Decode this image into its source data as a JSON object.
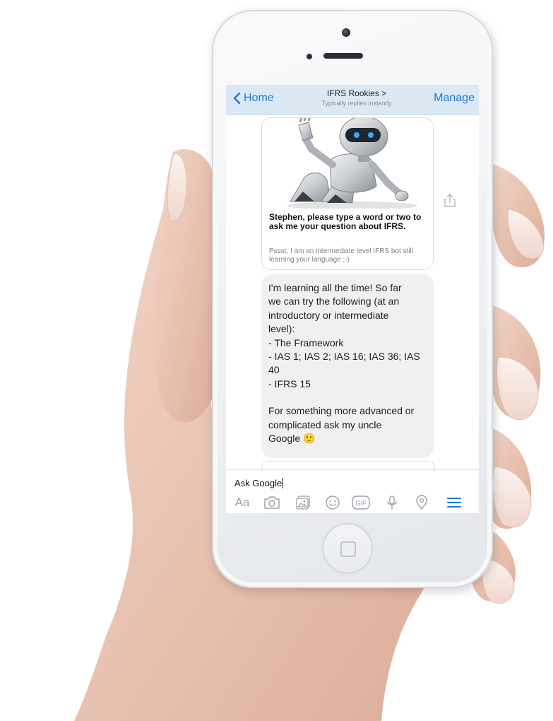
{
  "header": {
    "back_label": "Home",
    "title": "IFRS Rookies >",
    "subtitle": "Typically replies instantly",
    "manage_label": "Manage"
  },
  "card": {
    "title": "Stephen, please type a word or two to ask me your question about IFRS.",
    "subtitle": "Pssst, I am an intermediate level IFRS bot still learning your language ;-)"
  },
  "message": {
    "lines": [
      "I'm learning  all the time! So far",
      "we can try the following (at an",
      "introductory or intermediate",
      "level):",
      "- The Framework",
      "- IAS 1; IAS 2; IAS 16; IAS 36; IAS",
      "40",
      "- IFRS 15",
      "",
      "For something more advanced or",
      "complicated ask my uncle",
      "Google 🙂"
    ]
  },
  "composer": {
    "input_value": "Ask Google",
    "aa_label": "Aa",
    "gif_label": "GIF"
  },
  "colors": {
    "accent": "#1a7bd8",
    "navbar_bg": "#dbe9f5",
    "bubble_bg": "#f1f0f0",
    "icon_gray": "#9aa0a8"
  }
}
